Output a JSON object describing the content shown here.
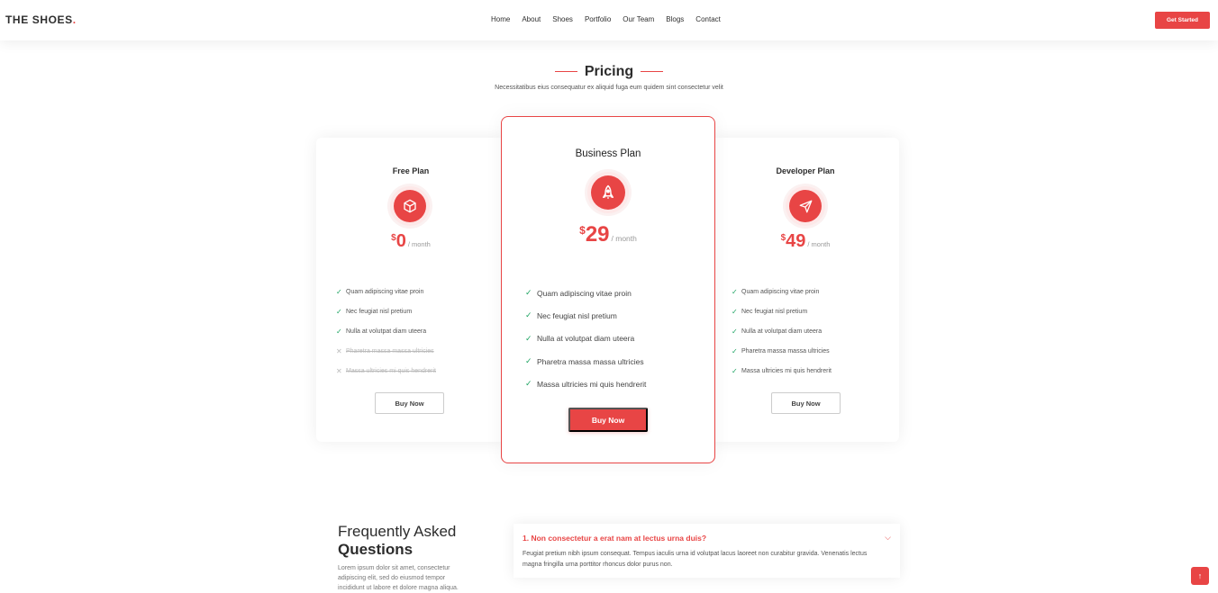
{
  "brand": {
    "name": "THE SHOES",
    "dot": ".",
    "accent": "#e84545"
  },
  "nav": {
    "items": [
      "Home",
      "About",
      "Shoes",
      "Portfolio",
      "Our Team",
      "Blogs",
      "Contact"
    ],
    "cta": "Get Started"
  },
  "pricing": {
    "title": "Pricing",
    "subtitle": "Necessitatibus eius consequatur ex aliquid fuga eum quidem sint consectetur velit",
    "plans": [
      {
        "name": "Free Plan",
        "icon": "box-icon",
        "currency": "$",
        "amount": "0",
        "period": "/ month",
        "features": [
          {
            "text": "Quam adipiscing vitae proin",
            "included": true
          },
          {
            "text": "Nec feugiat nisl pretium",
            "included": true
          },
          {
            "text": "Nulla at volutpat diam uteera",
            "included": true
          },
          {
            "text": "Pharetra massa massa ultricies",
            "included": false
          },
          {
            "text": "Massa ultricies mi quis hendrerit",
            "included": false
          }
        ],
        "button": "Buy Now"
      },
      {
        "name": "Business Plan",
        "icon": "rocket-icon",
        "currency": "$",
        "amount": "29",
        "period": "/ month",
        "features": [
          {
            "text": "Quam adipiscing vitae proin",
            "included": true
          },
          {
            "text": "Nec feugiat nisl pretium",
            "included": true
          },
          {
            "text": "Nulla at volutpat diam uteera",
            "included": true
          },
          {
            "text": "Pharetra massa massa ultricies",
            "included": true
          },
          {
            "text": "Massa ultricies mi quis hendrerit",
            "included": true
          }
        ],
        "button": "Buy Now"
      },
      {
        "name": "Developer Plan",
        "icon": "send-icon",
        "currency": "$",
        "amount": "49",
        "period": "/ month",
        "features": [
          {
            "text": "Quam adipiscing vitae proin",
            "included": true
          },
          {
            "text": "Nec feugiat nisl pretium",
            "included": true
          },
          {
            "text": "Nulla at volutpat diam uteera",
            "included": true
          },
          {
            "text": "Pharetra massa massa ultricies",
            "included": true
          },
          {
            "text": "Massa ultricies mi quis hendrerit",
            "included": true
          }
        ],
        "button": "Buy Now"
      }
    ]
  },
  "faq": {
    "title_line1": "Frequently Asked",
    "title_line2": "Questions",
    "description": "Lorem ipsum dolor sit amet, consectetur adipiscing elit, sed do eiusmod tempor incididunt ut labore et dolore magna aliqua.",
    "items": [
      {
        "question": "1. Non consectetur a erat nam at lectus urna duis?",
        "answer": "Feugiat pretium nibh ipsum consequat. Tempus iaculis urna id volutpat lacus laoreet non curabitur gravida. Venenatis lectus magna fringilla urna porttitor rhoncus dolor purus non."
      }
    ]
  },
  "icons": {
    "check": "check-icon",
    "cross": "x-icon",
    "chevron": "chevron-down-icon",
    "back_to_top": "arrow-up-icon"
  }
}
